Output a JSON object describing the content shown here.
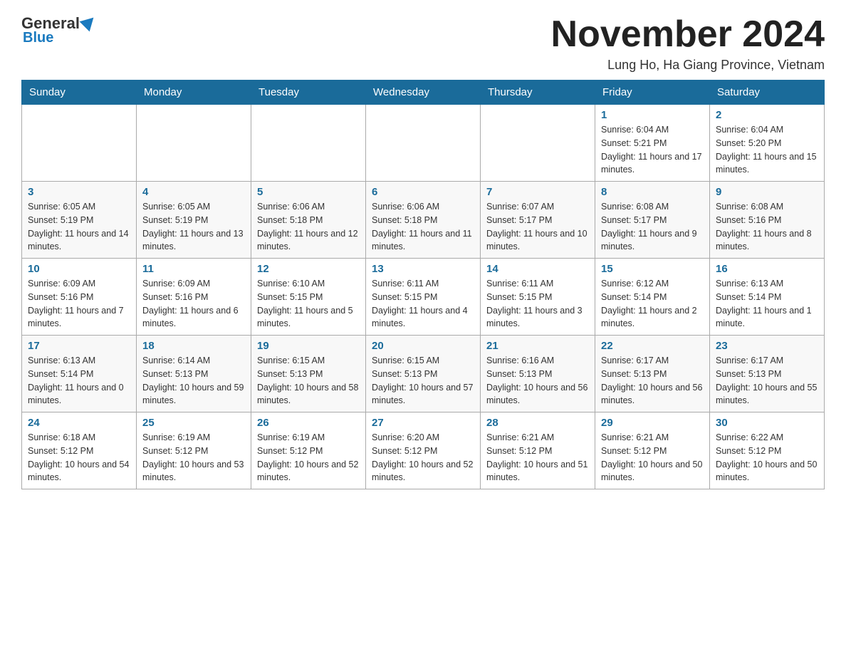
{
  "header": {
    "logo_general": "General",
    "logo_blue": "Blue",
    "month_title": "November 2024",
    "location": "Lung Ho, Ha Giang Province, Vietnam"
  },
  "weekdays": [
    "Sunday",
    "Monday",
    "Tuesday",
    "Wednesday",
    "Thursday",
    "Friday",
    "Saturday"
  ],
  "weeks": [
    [
      {
        "day": "",
        "sunrise": "",
        "sunset": "",
        "daylight": ""
      },
      {
        "day": "",
        "sunrise": "",
        "sunset": "",
        "daylight": ""
      },
      {
        "day": "",
        "sunrise": "",
        "sunset": "",
        "daylight": ""
      },
      {
        "day": "",
        "sunrise": "",
        "sunset": "",
        "daylight": ""
      },
      {
        "day": "",
        "sunrise": "",
        "sunset": "",
        "daylight": ""
      },
      {
        "day": "1",
        "sunrise": "Sunrise: 6:04 AM",
        "sunset": "Sunset: 5:21 PM",
        "daylight": "Daylight: 11 hours and 17 minutes."
      },
      {
        "day": "2",
        "sunrise": "Sunrise: 6:04 AM",
        "sunset": "Sunset: 5:20 PM",
        "daylight": "Daylight: 11 hours and 15 minutes."
      }
    ],
    [
      {
        "day": "3",
        "sunrise": "Sunrise: 6:05 AM",
        "sunset": "Sunset: 5:19 PM",
        "daylight": "Daylight: 11 hours and 14 minutes."
      },
      {
        "day": "4",
        "sunrise": "Sunrise: 6:05 AM",
        "sunset": "Sunset: 5:19 PM",
        "daylight": "Daylight: 11 hours and 13 minutes."
      },
      {
        "day": "5",
        "sunrise": "Sunrise: 6:06 AM",
        "sunset": "Sunset: 5:18 PM",
        "daylight": "Daylight: 11 hours and 12 minutes."
      },
      {
        "day": "6",
        "sunrise": "Sunrise: 6:06 AM",
        "sunset": "Sunset: 5:18 PM",
        "daylight": "Daylight: 11 hours and 11 minutes."
      },
      {
        "day": "7",
        "sunrise": "Sunrise: 6:07 AM",
        "sunset": "Sunset: 5:17 PM",
        "daylight": "Daylight: 11 hours and 10 minutes."
      },
      {
        "day": "8",
        "sunrise": "Sunrise: 6:08 AM",
        "sunset": "Sunset: 5:17 PM",
        "daylight": "Daylight: 11 hours and 9 minutes."
      },
      {
        "day": "9",
        "sunrise": "Sunrise: 6:08 AM",
        "sunset": "Sunset: 5:16 PM",
        "daylight": "Daylight: 11 hours and 8 minutes."
      }
    ],
    [
      {
        "day": "10",
        "sunrise": "Sunrise: 6:09 AM",
        "sunset": "Sunset: 5:16 PM",
        "daylight": "Daylight: 11 hours and 7 minutes."
      },
      {
        "day": "11",
        "sunrise": "Sunrise: 6:09 AM",
        "sunset": "Sunset: 5:16 PM",
        "daylight": "Daylight: 11 hours and 6 minutes."
      },
      {
        "day": "12",
        "sunrise": "Sunrise: 6:10 AM",
        "sunset": "Sunset: 5:15 PM",
        "daylight": "Daylight: 11 hours and 5 minutes."
      },
      {
        "day": "13",
        "sunrise": "Sunrise: 6:11 AM",
        "sunset": "Sunset: 5:15 PM",
        "daylight": "Daylight: 11 hours and 4 minutes."
      },
      {
        "day": "14",
        "sunrise": "Sunrise: 6:11 AM",
        "sunset": "Sunset: 5:15 PM",
        "daylight": "Daylight: 11 hours and 3 minutes."
      },
      {
        "day": "15",
        "sunrise": "Sunrise: 6:12 AM",
        "sunset": "Sunset: 5:14 PM",
        "daylight": "Daylight: 11 hours and 2 minutes."
      },
      {
        "day": "16",
        "sunrise": "Sunrise: 6:13 AM",
        "sunset": "Sunset: 5:14 PM",
        "daylight": "Daylight: 11 hours and 1 minute."
      }
    ],
    [
      {
        "day": "17",
        "sunrise": "Sunrise: 6:13 AM",
        "sunset": "Sunset: 5:14 PM",
        "daylight": "Daylight: 11 hours and 0 minutes."
      },
      {
        "day": "18",
        "sunrise": "Sunrise: 6:14 AM",
        "sunset": "Sunset: 5:13 PM",
        "daylight": "Daylight: 10 hours and 59 minutes."
      },
      {
        "day": "19",
        "sunrise": "Sunrise: 6:15 AM",
        "sunset": "Sunset: 5:13 PM",
        "daylight": "Daylight: 10 hours and 58 minutes."
      },
      {
        "day": "20",
        "sunrise": "Sunrise: 6:15 AM",
        "sunset": "Sunset: 5:13 PM",
        "daylight": "Daylight: 10 hours and 57 minutes."
      },
      {
        "day": "21",
        "sunrise": "Sunrise: 6:16 AM",
        "sunset": "Sunset: 5:13 PM",
        "daylight": "Daylight: 10 hours and 56 minutes."
      },
      {
        "day": "22",
        "sunrise": "Sunrise: 6:17 AM",
        "sunset": "Sunset: 5:13 PM",
        "daylight": "Daylight: 10 hours and 56 minutes."
      },
      {
        "day": "23",
        "sunrise": "Sunrise: 6:17 AM",
        "sunset": "Sunset: 5:13 PM",
        "daylight": "Daylight: 10 hours and 55 minutes."
      }
    ],
    [
      {
        "day": "24",
        "sunrise": "Sunrise: 6:18 AM",
        "sunset": "Sunset: 5:12 PM",
        "daylight": "Daylight: 10 hours and 54 minutes."
      },
      {
        "day": "25",
        "sunrise": "Sunrise: 6:19 AM",
        "sunset": "Sunset: 5:12 PM",
        "daylight": "Daylight: 10 hours and 53 minutes."
      },
      {
        "day": "26",
        "sunrise": "Sunrise: 6:19 AM",
        "sunset": "Sunset: 5:12 PM",
        "daylight": "Daylight: 10 hours and 52 minutes."
      },
      {
        "day": "27",
        "sunrise": "Sunrise: 6:20 AM",
        "sunset": "Sunset: 5:12 PM",
        "daylight": "Daylight: 10 hours and 52 minutes."
      },
      {
        "day": "28",
        "sunrise": "Sunrise: 6:21 AM",
        "sunset": "Sunset: 5:12 PM",
        "daylight": "Daylight: 10 hours and 51 minutes."
      },
      {
        "day": "29",
        "sunrise": "Sunrise: 6:21 AM",
        "sunset": "Sunset: 5:12 PM",
        "daylight": "Daylight: 10 hours and 50 minutes."
      },
      {
        "day": "30",
        "sunrise": "Sunrise: 6:22 AM",
        "sunset": "Sunset: 5:12 PM",
        "daylight": "Daylight: 10 hours and 50 minutes."
      }
    ]
  ]
}
